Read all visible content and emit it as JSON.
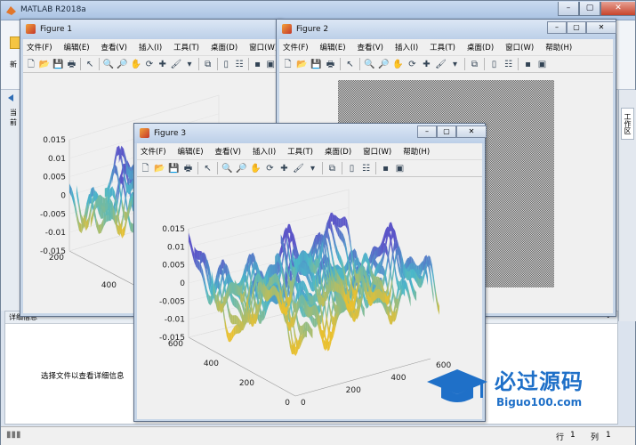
{
  "main": {
    "title": "MATLAB R2018a",
    "detail_header": "详细信息",
    "detail_text": "选择文件以查看详细信息",
    "ribbon_fragment": "新",
    "left_fragment": "当前",
    "right_tab": "工作区",
    "status": {
      "row_label": "行",
      "row_value": "1",
      "col_label": "列",
      "col_value": "1"
    }
  },
  "menu": [
    "文件(F)",
    "编辑(E)",
    "查看(V)",
    "插入(I)",
    "工具(T)",
    "桌面(D)",
    "窗口(W)",
    "帮助(H)"
  ],
  "figures": {
    "fig1": {
      "title": "Figure 1",
      "menu_last": "帮助"
    },
    "fig2": {
      "title": "Figure 2"
    },
    "fig3": {
      "title": "Figure 3"
    }
  },
  "watermark": {
    "brand": "必过源码",
    "site": "Biguo100.com"
  },
  "colors": {
    "accent": "#1f70c8",
    "surface_low": "#e9c02f",
    "surface_mid": "#4bb8c9",
    "surface_high": "#5b54c8"
  },
  "chart_data": {
    "type": "surface",
    "zlim": [
      -0.015,
      0.015
    ],
    "z_ticks": [
      "0.015",
      "0.01",
      "0.005",
      "0",
      "-0.005",
      "-0.01",
      "-0.015"
    ],
    "x_ticks": [
      "0",
      "200",
      "400",
      "600"
    ],
    "y_ticks": [
      "0",
      "200",
      "400",
      "600"
    ],
    "fig1_z_ticks": [
      "0.015",
      "0.01",
      "0.005",
      "0",
      "-0.005",
      "-0.01",
      "-0.015"
    ],
    "fig1_y_ticks": [
      "600",
      "400",
      "200"
    ]
  }
}
